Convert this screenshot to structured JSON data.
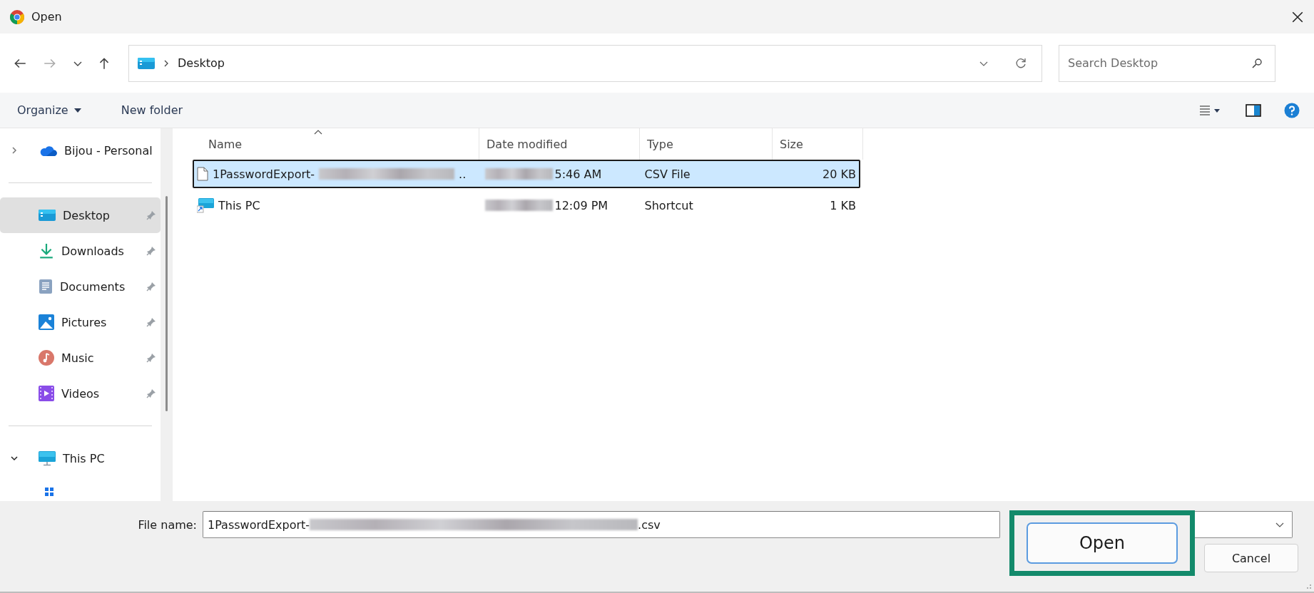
{
  "window": {
    "title": "Open"
  },
  "navigation": {
    "back_enabled": true,
    "forward_enabled": false,
    "path": [
      "Desktop"
    ]
  },
  "search": {
    "placeholder": "Search Desktop"
  },
  "toolbar": {
    "organize": "Organize",
    "new_folder": "New folder"
  },
  "sidebar": {
    "items": [
      {
        "label": "Bijou - Personal",
        "kind": "cloud",
        "selected": false,
        "pinned": false,
        "expanded": false
      },
      {
        "kind": "divider"
      },
      {
        "label": "Desktop",
        "kind": "desktop",
        "selected": true,
        "pinned": true
      },
      {
        "label": "Downloads",
        "kind": "downloads",
        "selected": false,
        "pinned": true
      },
      {
        "label": "Documents",
        "kind": "documents",
        "selected": false,
        "pinned": true
      },
      {
        "label": "Pictures",
        "kind": "pictures",
        "selected": false,
        "pinned": true
      },
      {
        "label": "Music",
        "kind": "music",
        "selected": false,
        "pinned": true
      },
      {
        "label": "Videos",
        "kind": "videos",
        "selected": false,
        "pinned": true
      },
      {
        "kind": "divider"
      },
      {
        "label": "This PC",
        "kind": "pc",
        "selected": false,
        "pinned": false,
        "expanded": true
      }
    ]
  },
  "table": {
    "columns": [
      "Name",
      "Date modified",
      "Type",
      "Size"
    ],
    "rows": [
      {
        "kind": "csv",
        "name": "1PasswordExport-",
        "name_redacted": true,
        "name_end": "..",
        "date": "5:46 AM",
        "date_redacted": true,
        "type": "CSV File",
        "size": "20 KB",
        "selected": true
      },
      {
        "kind": "shortcut",
        "name": "This PC",
        "name_redacted": false,
        "date": "12:09 PM",
        "date_redacted": true,
        "type": "Shortcut",
        "size": "1 KB",
        "selected": false
      }
    ]
  },
  "file_name": {
    "label": "File name:",
    "value_start": "1PasswordExport-",
    "redacted": true,
    "value_end": ".csv"
  },
  "buttons": [
    {
      "label": "Open",
      "kind": "primary",
      "highlighted": true
    },
    {
      "label": "Cancel",
      "kind": "secondary",
      "highlighted": false
    }
  ]
}
